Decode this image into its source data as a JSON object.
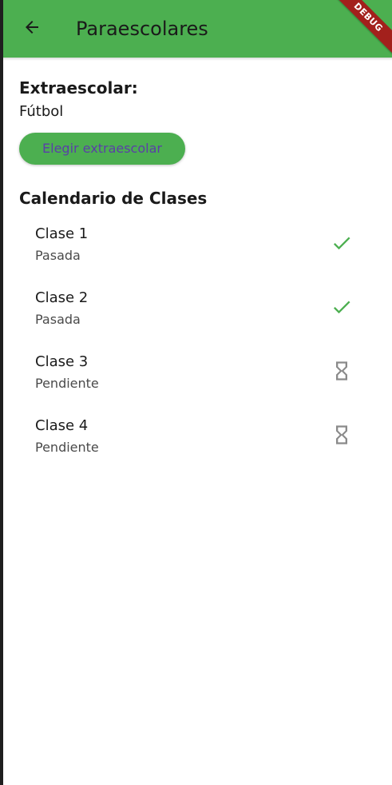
{
  "appbar": {
    "title": "Paraescolares",
    "back_icon": "arrow-back-icon",
    "debug_label": "DEBUG",
    "color": "#4caf50"
  },
  "activity": {
    "label": "Extraescolar:",
    "value": "Fútbol"
  },
  "choose_button": {
    "label": "Elegir extraescolar",
    "text_color": "#5a3fa8",
    "background": "#4caf50"
  },
  "calendar": {
    "title": "Calendario de Clases",
    "items": [
      {
        "title": "Clase 1",
        "status": "Pasada",
        "icon": "check-icon",
        "icon_color": "#4caf50"
      },
      {
        "title": "Clase 2",
        "status": "Pasada",
        "icon": "check-icon",
        "icon_color": "#4caf50"
      },
      {
        "title": "Clase 3",
        "status": "Pendiente",
        "icon": "hourglass-icon",
        "icon_color": "#8a8a8a"
      },
      {
        "title": "Clase 4",
        "status": "Pendiente",
        "icon": "hourglass-icon",
        "icon_color": "#8a8a8a"
      }
    ]
  }
}
